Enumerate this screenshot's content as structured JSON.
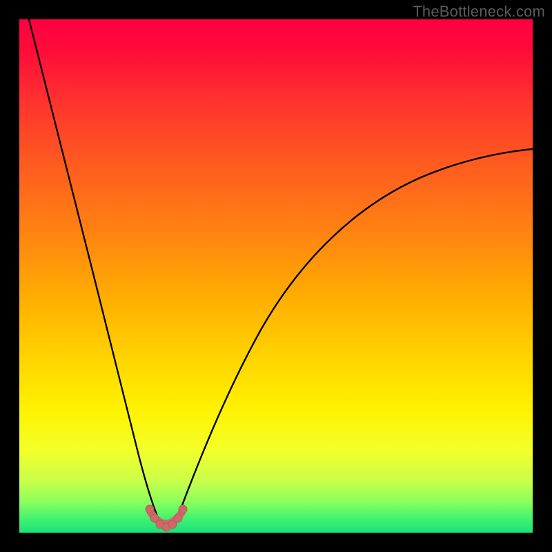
{
  "watermark": {
    "text": "TheBottleneck.com"
  },
  "colors": {
    "page_bg": "#000000",
    "curve": "#000000",
    "marker_fill": "#cc6a6a",
    "marker_stroke": "#b95a5a",
    "gradient_stops": [
      "#ff0040",
      "#ff5a20",
      "#ffd400",
      "#fff200",
      "#46f46e",
      "#18e27c"
    ]
  },
  "chart_data": {
    "type": "line",
    "title": "",
    "xlabel": "",
    "ylabel": "",
    "xlim": [
      0,
      100
    ],
    "ylim": [
      0,
      100
    ],
    "legend": false,
    "grid": false,
    "annotations": [],
    "series": [
      {
        "name": "left-branch",
        "x": [
          2,
          4,
          6,
          8,
          10,
          12,
          14,
          16,
          18,
          20,
          22,
          24,
          25,
          26,
          27
        ],
        "y": [
          100,
          92,
          84,
          76,
          68,
          60,
          52,
          44,
          36,
          28,
          20,
          12,
          7,
          3,
          1
        ]
      },
      {
        "name": "right-branch",
        "x": [
          31,
          32,
          34,
          36,
          38,
          41,
          44,
          48,
          52,
          57,
          62,
          68,
          74,
          80,
          87,
          94,
          100
        ],
        "y": [
          1,
          3,
          7,
          12,
          18,
          24,
          31,
          38,
          44,
          50,
          55,
          60,
          64,
          67,
          70,
          72,
          74
        ]
      },
      {
        "name": "valley-markers",
        "type": "scatter",
        "x": [
          25,
          26,
          27,
          28,
          29,
          30,
          31,
          32
        ],
        "y": [
          3.5,
          2.0,
          1.0,
          0.6,
          0.6,
          1.0,
          2.0,
          3.5
        ]
      }
    ],
    "valley_center_x": 28.5,
    "background": "red-to-green vertical gradient"
  }
}
